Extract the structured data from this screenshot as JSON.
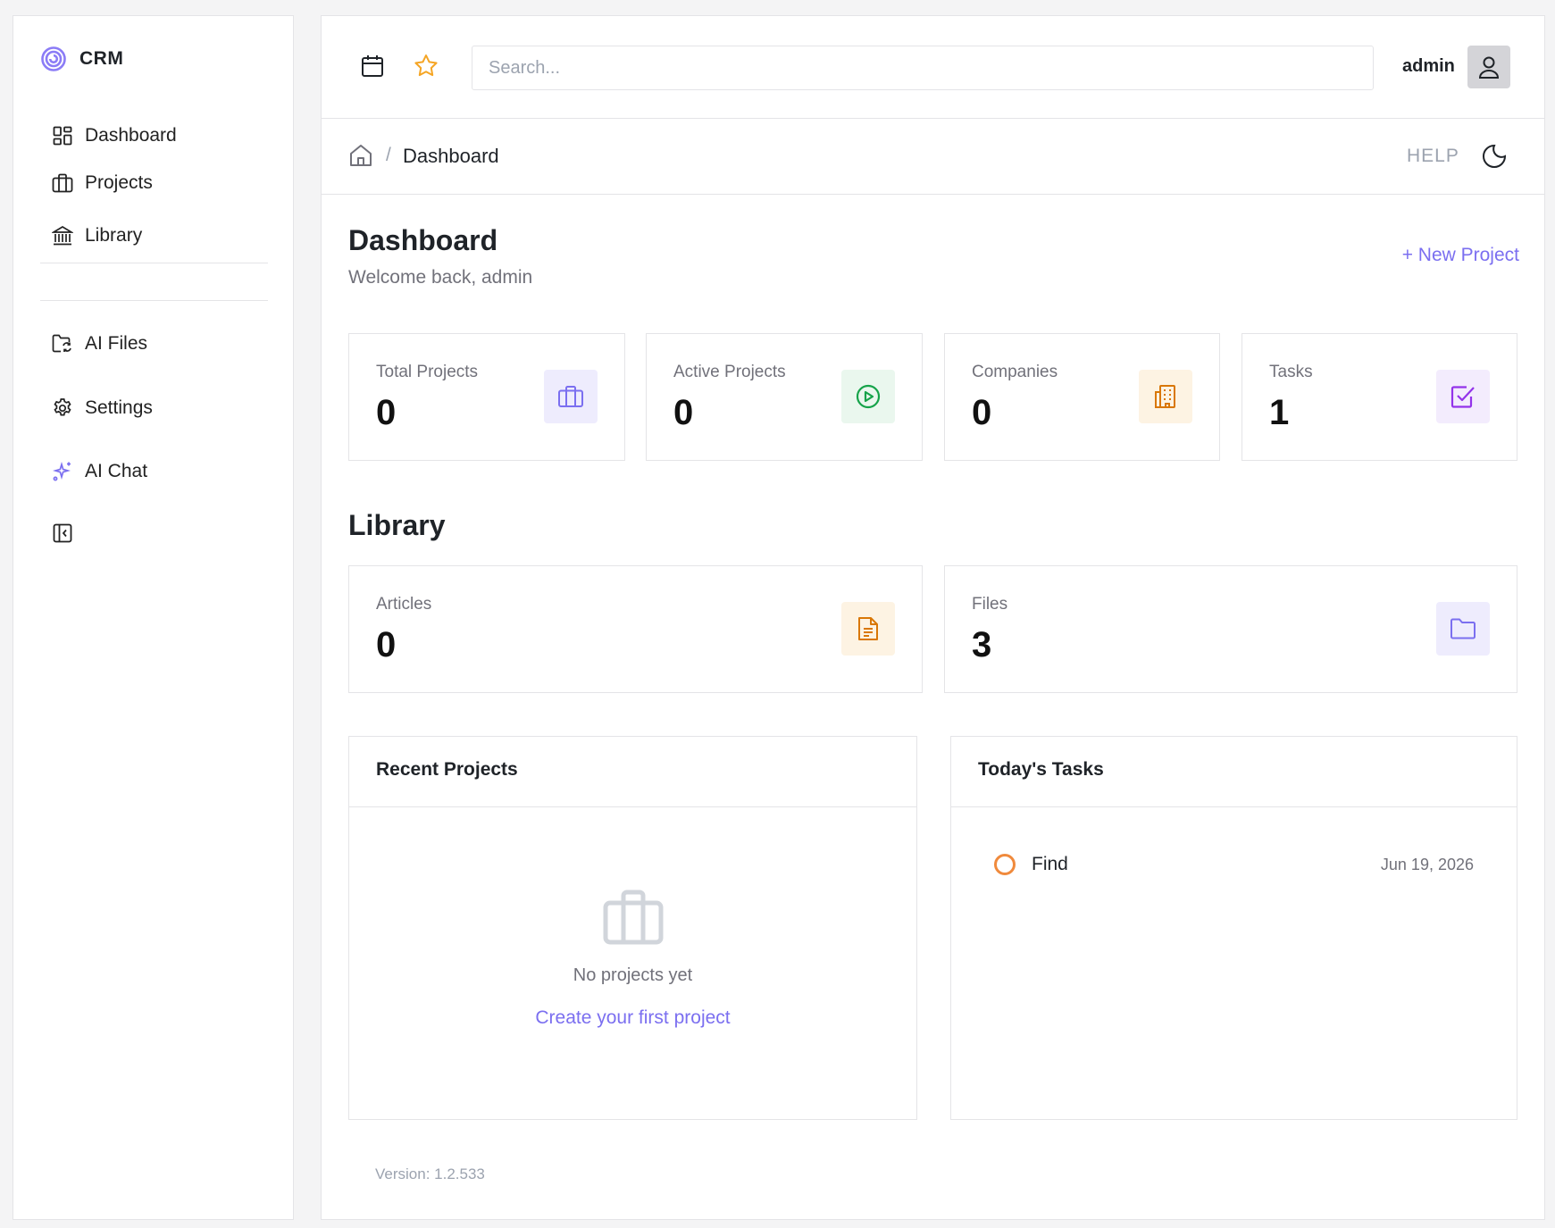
{
  "sidebar": {
    "brand": "CRM",
    "nav": [
      {
        "label": "Dashboard",
        "icon": "dashboard-grid-icon"
      },
      {
        "label": "Projects",
        "icon": "briefcase-icon"
      },
      {
        "label": "Library",
        "icon": "library-icon"
      }
    ],
    "nav2": [
      {
        "label": "AI Files",
        "icon": "ai-files-icon"
      },
      {
        "label": "Settings",
        "icon": "gear-icon"
      },
      {
        "label": "AI Chat",
        "icon": "sparkles-icon"
      }
    ],
    "collapse_icon": "sidebar-collapse-icon"
  },
  "topbar": {
    "search_placeholder": "Search...",
    "user": "admin",
    "icons": [
      "calendar-icon",
      "star-icon",
      "user-icon"
    ]
  },
  "breadcrumb": {
    "current": "Dashboard",
    "separator": "/",
    "help": "HELP"
  },
  "page": {
    "title": "Dashboard",
    "welcome": "Welcome back, admin",
    "new_project": "+ New Project"
  },
  "stats": [
    {
      "label": "Total Projects",
      "value": "0",
      "icon": "briefcase-icon",
      "color": "#7b6ff0",
      "bg": "#eeecfd"
    },
    {
      "label": "Active Projects",
      "value": "0",
      "icon": "play-circle-icon",
      "color": "#16a34a",
      "bg": "#eaf7ee"
    },
    {
      "label": "Companies",
      "value": "0",
      "icon": "building-icon",
      "color": "#d97706",
      "bg": "#fdf3e3"
    },
    {
      "label": "Tasks",
      "value": "1",
      "icon": "check-square-icon",
      "color": "#9333ea",
      "bg": "#f3ecfd"
    }
  ],
  "library": {
    "title": "Library",
    "items": [
      {
        "label": "Articles",
        "value": "0",
        "icon": "document-icon",
        "color": "#d97706",
        "bg": "#fdf3e3"
      },
      {
        "label": "Files",
        "value": "3",
        "icon": "folder-icon",
        "color": "#7b6ff0",
        "bg": "#eeecfd"
      }
    ]
  },
  "recent_projects": {
    "title": "Recent Projects",
    "empty_message": "No projects yet",
    "empty_link": "Create your first project"
  },
  "todays_tasks": {
    "title": "Today's Tasks",
    "items": [
      {
        "title": "Find",
        "date": "Jun 19, 2026"
      }
    ]
  },
  "footer": {
    "version": "Version: 1.2.533"
  },
  "colors": {
    "accent": "#7b6ff0",
    "task_pending": "#f08a3c"
  }
}
